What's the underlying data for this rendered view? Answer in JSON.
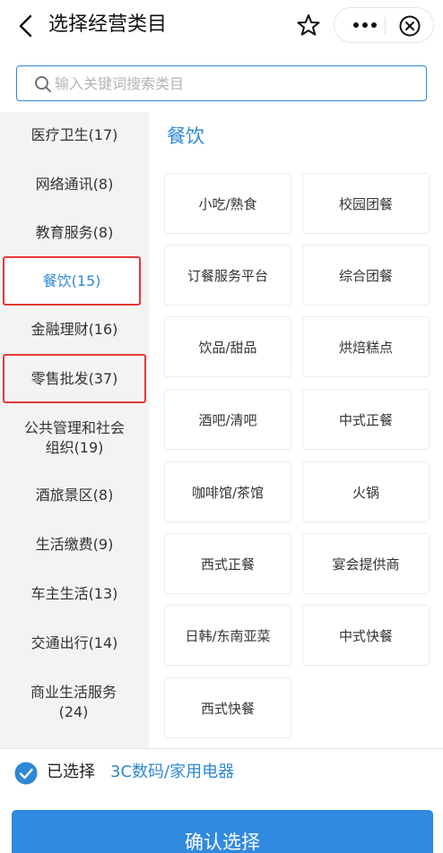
{
  "header": {
    "title": "选择经营类目",
    "icons": [
      "back-icon",
      "star-icon",
      "more-icon",
      "close-icon"
    ]
  },
  "search": {
    "placeholder": "输入关键词搜索类目",
    "value": ""
  },
  "sidebar": {
    "items": [
      {
        "label": "医疗卫生(17)",
        "active": false,
        "boxed": false
      },
      {
        "label": "网络通讯(8)",
        "active": false,
        "boxed": false
      },
      {
        "label": "教育服务(8)",
        "active": false,
        "boxed": false
      },
      {
        "label": "餐饮(15)",
        "active": true,
        "boxed": true
      },
      {
        "label": "金融理财(16)",
        "active": false,
        "boxed": false
      },
      {
        "label": "零售批发(37)",
        "active": false,
        "boxed": true
      },
      {
        "label": "公共管理和社会组织(19)",
        "active": false,
        "boxed": false
      },
      {
        "label": "酒旅景区(8)",
        "active": false,
        "boxed": false
      },
      {
        "label": "生活缴费(9)",
        "active": false,
        "boxed": false
      },
      {
        "label": "车主生活(13)",
        "active": false,
        "boxed": false
      },
      {
        "label": "交通出行(14)",
        "active": false,
        "boxed": false
      },
      {
        "label": "商业生活服务(24)",
        "active": false,
        "boxed": false
      }
    ]
  },
  "content": {
    "section_title": "餐饮",
    "categories": [
      "小吃/熟食",
      "校园团餐",
      "订餐服务平台",
      "综合团餐",
      "饮品/甜品",
      "烘焙糕点",
      "酒吧/清吧",
      "中式正餐",
      "咖啡馆/茶馆",
      "火锅",
      "西式正餐",
      "宴会提供商",
      "日韩/东南亚菜",
      "中式快餐",
      "西式快餐"
    ]
  },
  "footer": {
    "selected_label": "已选择",
    "selected_value": "3C数码/家用电器",
    "confirm_label": "确认选择"
  },
  "colors": {
    "accent": "#2e88d6",
    "highlight_border": "#e53935",
    "sidebar_bg": "#f3f3f3"
  }
}
